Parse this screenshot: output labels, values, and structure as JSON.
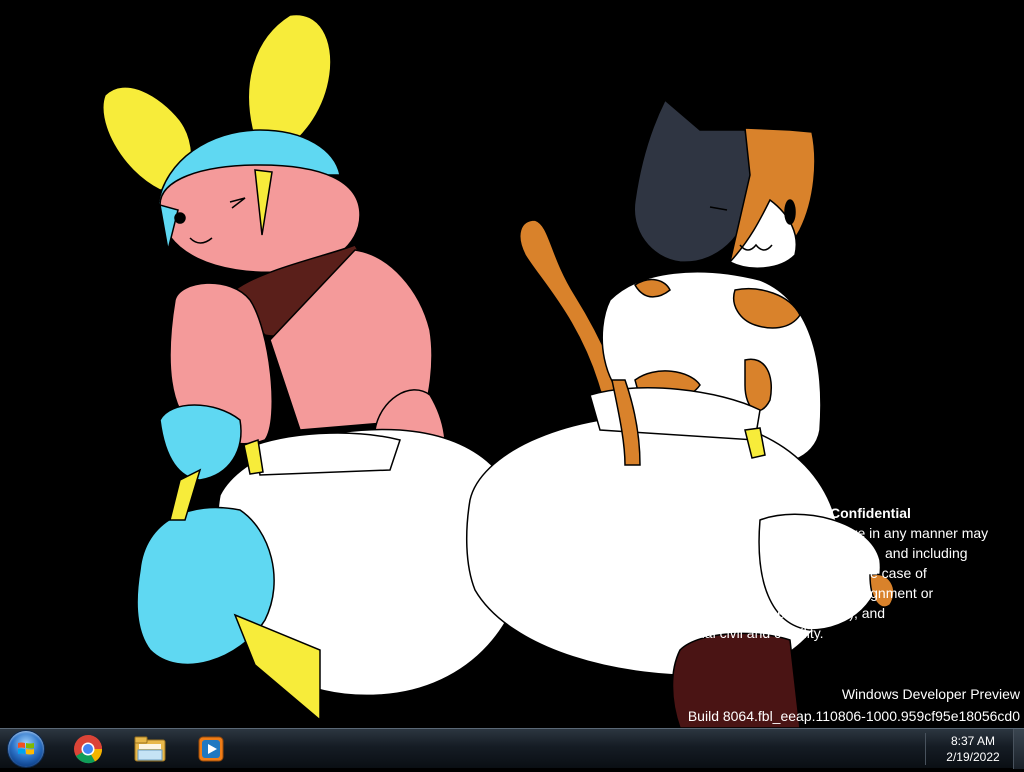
{
  "desktop": {
    "wallpaper": "cartoon-characters-wallpaper",
    "confidential": {
      "title": "Confidential",
      "lines": [
        "ure in any manner may",
        "and including",
        "e case of",
        "e), termin            ssignment or",
        "act (in the case      igent staff), and",
        "ntial civil and c      ability."
      ]
    },
    "build": {
      "name": "Windows Developer Preview",
      "number": "Build 8064.fbl_eeap.110806-1000.959cf95e18056cd0"
    }
  },
  "taskbar": {
    "start_icon": "windows-logo-icon",
    "pinned": [
      {
        "name": "Google Chrome",
        "icon": "chrome-icon"
      },
      {
        "name": "Windows Explorer",
        "icon": "folder-icon"
      },
      {
        "name": "Windows Media Player",
        "icon": "media-player-icon"
      }
    ],
    "clock": {
      "time": "8:37 AM",
      "date": "2/19/2022"
    }
  }
}
